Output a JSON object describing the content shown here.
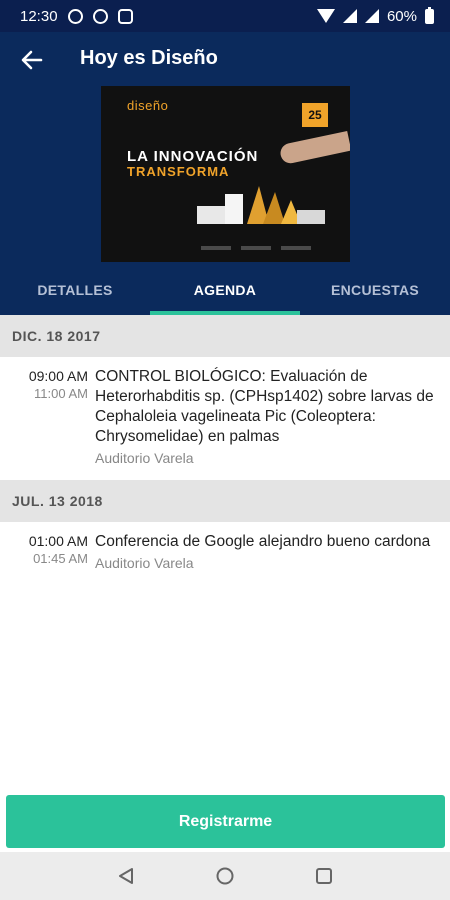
{
  "status_bar": {
    "time": "12:30",
    "battery": "60%",
    "icons": [
      "whatsapp-icon",
      "whatsapp-icon",
      "instagram-icon"
    ],
    "right_icons": [
      "wifi-icon",
      "signal-icon",
      "signal-icon",
      "battery-icon"
    ]
  },
  "header": {
    "title": "Hoy es Diseño",
    "back_icon": "arrow-left-icon"
  },
  "banner": {
    "logo_text": "diseño",
    "date_badge": "25",
    "headline_line1": "LA INNOVACIÓN",
    "headline_line2": "TRANSFORMA"
  },
  "tabs": [
    {
      "label": "DETALLES",
      "active": false
    },
    {
      "label": "AGENDA",
      "active": true
    },
    {
      "label": "ENCUESTAS",
      "active": false
    }
  ],
  "agenda": [
    {
      "date": "DIC. 18 2017",
      "events": [
        {
          "start": "09:00 AM",
          "end": "11:00 AM",
          "title": "CONTROL BIOLÓGICO: Evaluación de Heterorhabditis sp. (CPHsp1402) sobre larvas de Cephaloleia vagelineata Pic (Coleoptera: Chrysomelidae) en palmas",
          "location": "Auditorio Varela"
        }
      ]
    },
    {
      "date": "JUL. 13 2018",
      "events": [
        {
          "start": "01:00 AM",
          "end": "01:45 AM",
          "title": "Conferencia de Google alejandro bueno cardona",
          "location": "Auditorio Varela"
        }
      ]
    }
  ],
  "register_button": "Registrarme",
  "colors": {
    "header_bg": "#0b2a5c",
    "accent": "#2bc29a",
    "section_bg": "#e4e4e4"
  },
  "nav_bar": {
    "icons": [
      "back-triangle-icon",
      "home-circle-icon",
      "recents-square-icon"
    ]
  }
}
